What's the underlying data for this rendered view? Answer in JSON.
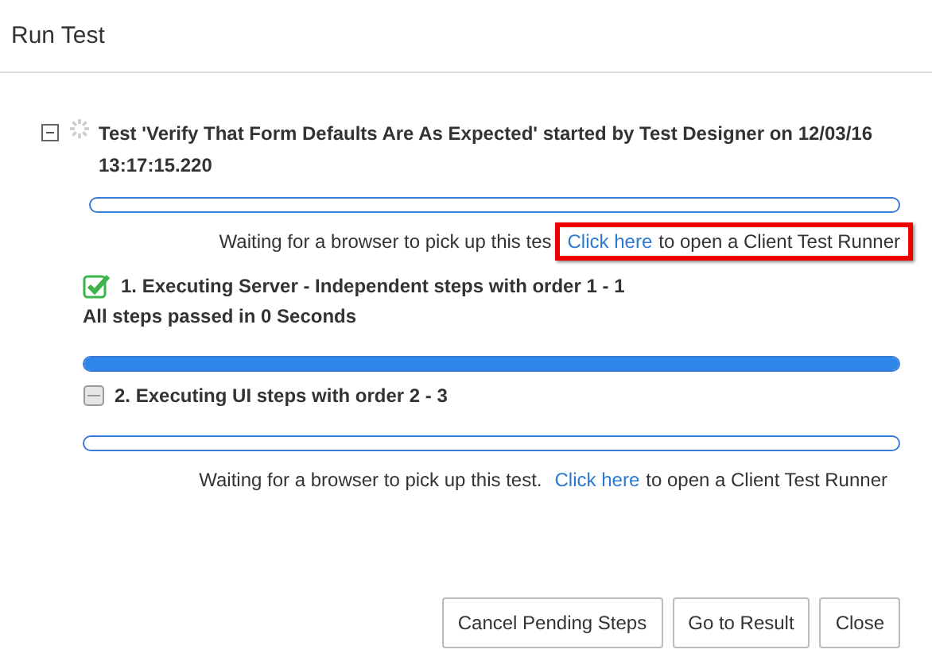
{
  "window": {
    "title": "Run Test"
  },
  "test": {
    "expanded": true,
    "heading": "Test 'Verify That Form Defaults Are As Expected' started by Test Designer on 12/03/16 13:17:15.220",
    "level": 0,
    "message": {
      "before": "Waiting for a browser to pick up this tes",
      "link": "Click here",
      "after": "to open a Client Test Runner",
      "highlighted": true
    }
  },
  "steps": [
    {
      "kind": "passed",
      "title": "1. Executing Server - Independent steps with order 1 - 1",
      "summary": "All steps passed in 0 Seconds",
      "level": 1
    },
    {
      "kind": "pending",
      "title": "2. Executing UI steps with order 2 - 3",
      "level": 0,
      "message": {
        "before": "Waiting for a browser to pick up this test.",
        "link": "Click here",
        "after": "to open a Client Test Runner",
        "highlighted": false
      }
    }
  ],
  "buttons": [
    "Cancel Pending Steps",
    "Go to Result",
    "Close"
  ]
}
